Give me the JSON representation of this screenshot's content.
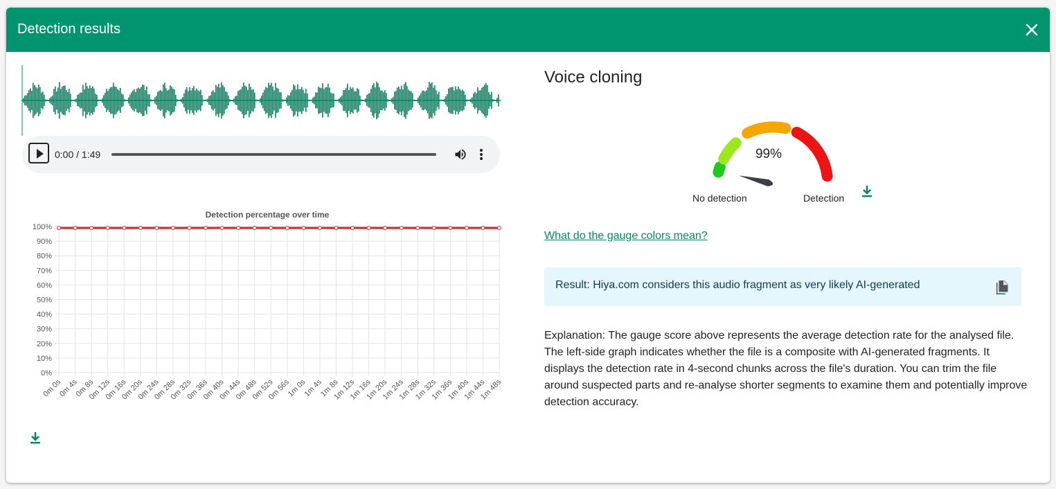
{
  "dialog": {
    "title": "Detection results"
  },
  "audio": {
    "time_label": "0:00 / 1:49"
  },
  "chart_data": {
    "type": "line",
    "title": "Detection percentage over time",
    "xlabel": "",
    "ylabel": "",
    "categories": [
      "0m 0s",
      "0m 4s",
      "0m 8s",
      "0m 12s",
      "0m 16s",
      "0m 20s",
      "0m 24s",
      "0m 28s",
      "0m 32s",
      "0m 36s",
      "0m 40s",
      "0m 44s",
      "0m 48s",
      "0m 52s",
      "0m 56s",
      "1m 0s",
      "1m 4s",
      "1m 8s",
      "1m 12s",
      "1m 16s",
      "1m 20s",
      "1m 24s",
      "1m 28s",
      "1m 32s",
      "1m 36s",
      "1m 40s",
      "1m 44s",
      "1m 48s"
    ],
    "values": [
      99,
      99,
      99,
      99,
      99,
      99,
      99,
      99,
      99,
      99,
      99,
      99,
      99,
      99,
      99,
      99,
      99,
      99,
      99,
      99,
      99,
      99,
      99,
      99,
      99,
      99,
      99,
      99
    ],
    "ylim": [
      0,
      100
    ],
    "yticks": [
      "0%",
      "10%",
      "20%",
      "30%",
      "40%",
      "50%",
      "60%",
      "70%",
      "80%",
      "90%",
      "100%"
    ],
    "grid": true,
    "series_color": "#d62728"
  },
  "result_panel": {
    "title": "Voice cloning",
    "gauge_value": "99%",
    "gauge_score": 0.99,
    "gauge_label_left": "No detection",
    "gauge_label_right": "Detection",
    "help_link": "What do the gauge colors mean?",
    "result_text": "Result: Hiya.com considers this audio fragment as very likely AI-generated",
    "explanation": "Explanation: The gauge score above represents the average detection rate for the analysed file. The left-side graph indicates whether the file is a composite with AI-generated fragments. It displays the detection rate in 4-second chunks across the file's duration. You can trim the file around suspected parts and re-analyse shorter segments to examine them and potentially improve detection accuracy."
  },
  "colors": {
    "header": "#00956f",
    "waveform": "#008a63",
    "link": "#00876a",
    "result_bg": "#e5f6fd",
    "gauge_segments": [
      "#1ec91e",
      "#9be81e",
      "#f7a600",
      "#ec1414"
    ]
  },
  "icons": {
    "close": "close-icon",
    "play": "play-icon",
    "volume": "volume-icon",
    "more": "more-vert-icon",
    "download": "download-icon",
    "copy": "copy-icon"
  }
}
